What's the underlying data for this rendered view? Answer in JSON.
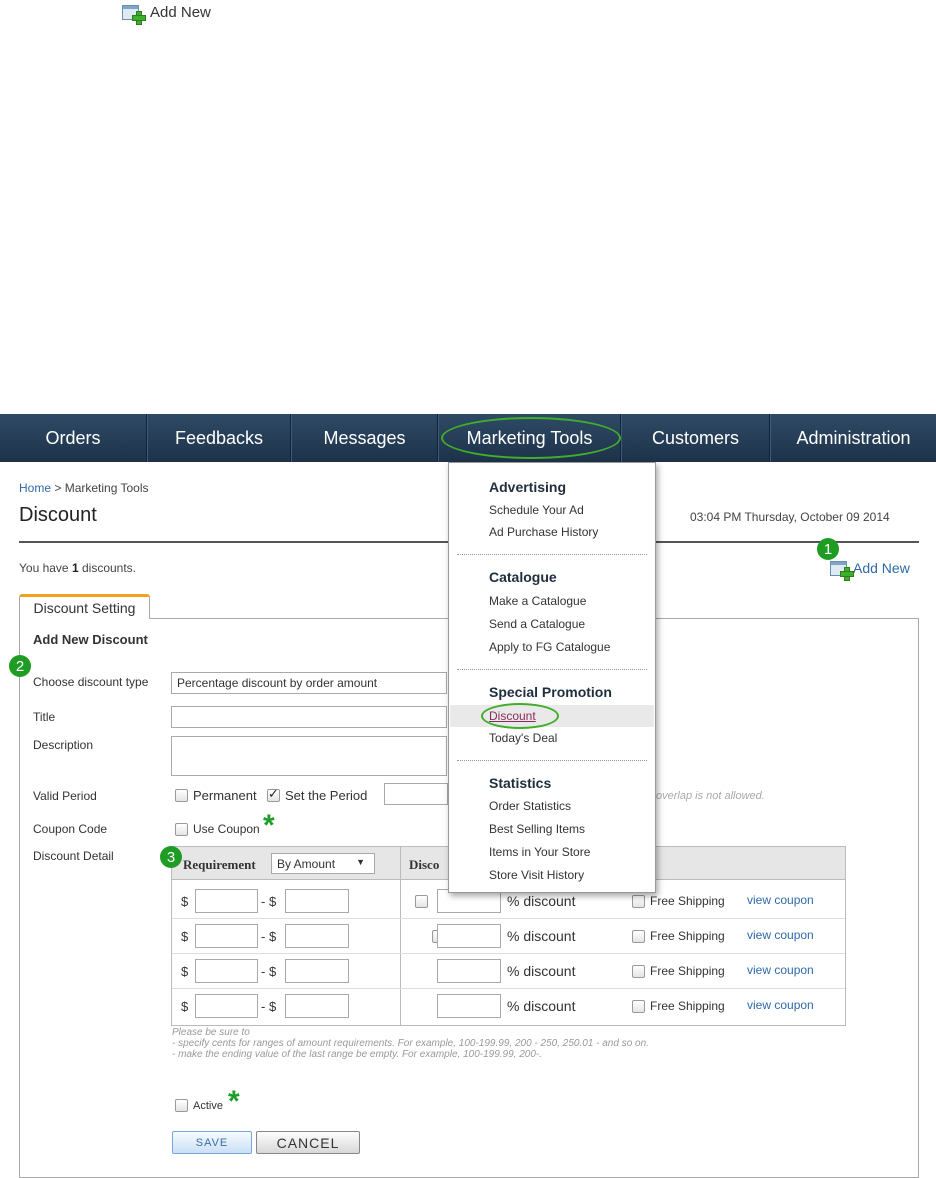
{
  "top": {
    "add_new_label": "Add New"
  },
  "nav": {
    "items": [
      "Orders",
      "Feedbacks",
      "Messages",
      "Marketing Tools",
      "Customers",
      "Administration"
    ]
  },
  "header": {
    "breadcrumb_home": "Home",
    "breadcrumb_sep": " > ",
    "breadcrumb_current": "Marketing Tools",
    "title": "Discount",
    "datetime": "03:04 PM Thursday, October 09 2014"
  },
  "summary": {
    "prefix": "You have ",
    "count": "1",
    "suffix": " discounts.",
    "add_new_label": "Add New"
  },
  "badges": [
    "1",
    "2",
    "3"
  ],
  "tab": {
    "label": "Discount Setting"
  },
  "form": {
    "section_title": "Add New Discount",
    "type_label": "Choose discount type",
    "type_value": "Percentage discount by order amount",
    "title_label": "Title",
    "description_label": "Description",
    "valid_period_label": "Valid Period",
    "permanent_label": "Permanent",
    "set_period_label": "Set the Period",
    "overlap_note": "overlap is not allowed.",
    "coupon_code_label": "Coupon Code",
    "use_coupon_label": "Use Coupon",
    "discount_detail_label": "Discount Detail",
    "requirement_label": "Requirement",
    "requirement_value": "By Amount",
    "discount_header": "Disco",
    "currency": "$",
    "range_sep": "- $",
    "percent_label": "% discount",
    "free_shipping_label": "Free Shipping",
    "view_coupon_label": "view coupon",
    "note_lines": [
      "Please be sure to",
      "- specify cents for ranges of amount requirements. For example, 100-199.99, 200 - 250, 250.01 - and so on.",
      "- make the ending value of the last range be empty. For example, 100-199.99, 200-."
    ],
    "active_label": "Active",
    "save_label": "SAVE",
    "cancel_label": "CANCEL",
    "star_glyph": "*"
  },
  "menu": {
    "advertising": {
      "heading": "Advertising",
      "items": [
        "Schedule Your Ad",
        "Ad Purchase History"
      ]
    },
    "catalogue": {
      "heading": "Catalogue",
      "items": [
        "Make a Catalogue",
        "Send a Catalogue",
        "Apply to FG Catalogue"
      ]
    },
    "special": {
      "heading": "Special Promotion",
      "items": [
        "Discount",
        "Today's Deal"
      ]
    },
    "statistics": {
      "heading": "Statistics",
      "items": [
        "Order Statistics",
        "Best Selling Items",
        "Items in Your Store",
        "Store Visit History"
      ]
    }
  },
  "colors": {
    "nav_bg": "#1d3249",
    "accent_green": "#1e9c24",
    "tab_accent": "#f2a21a",
    "link": "#2f6aa8",
    "menu_selected": "#8a2a5a"
  }
}
